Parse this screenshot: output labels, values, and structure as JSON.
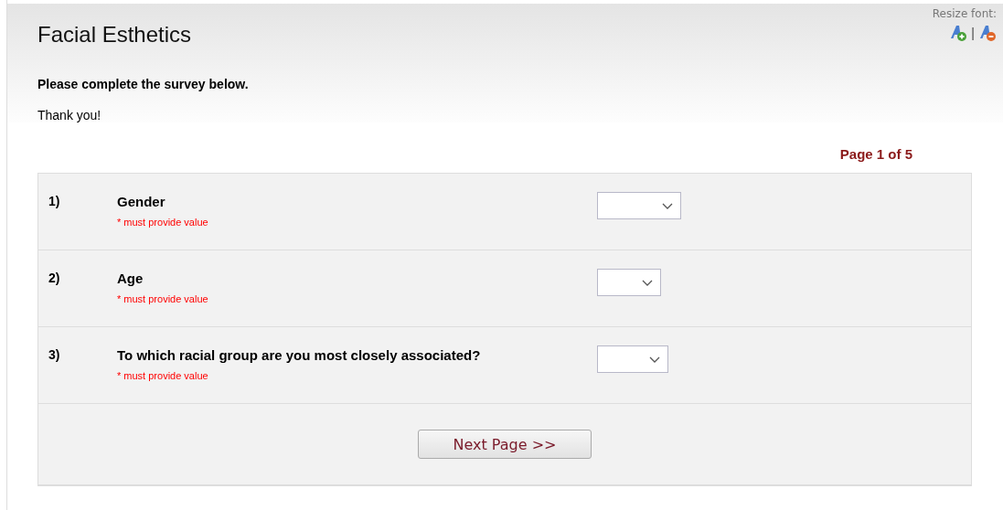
{
  "header": {
    "title": "Facial Esthetics",
    "resize_font": {
      "label": "Resize font:",
      "separator": "|"
    }
  },
  "intro": {
    "heading": "Please complete the survey below.",
    "thanks": "Thank you!"
  },
  "pager": "Page 1 of 5",
  "questions": [
    {
      "number": "1)",
      "label": "Gender",
      "hint": "* must provide value"
    },
    {
      "number": "2)",
      "label": "Age",
      "hint": "* must provide value"
    },
    {
      "number": "3)",
      "label": "To which racial group are you most closely associated?",
      "hint": "* must provide value"
    }
  ],
  "next_button": "Next Page >>"
}
